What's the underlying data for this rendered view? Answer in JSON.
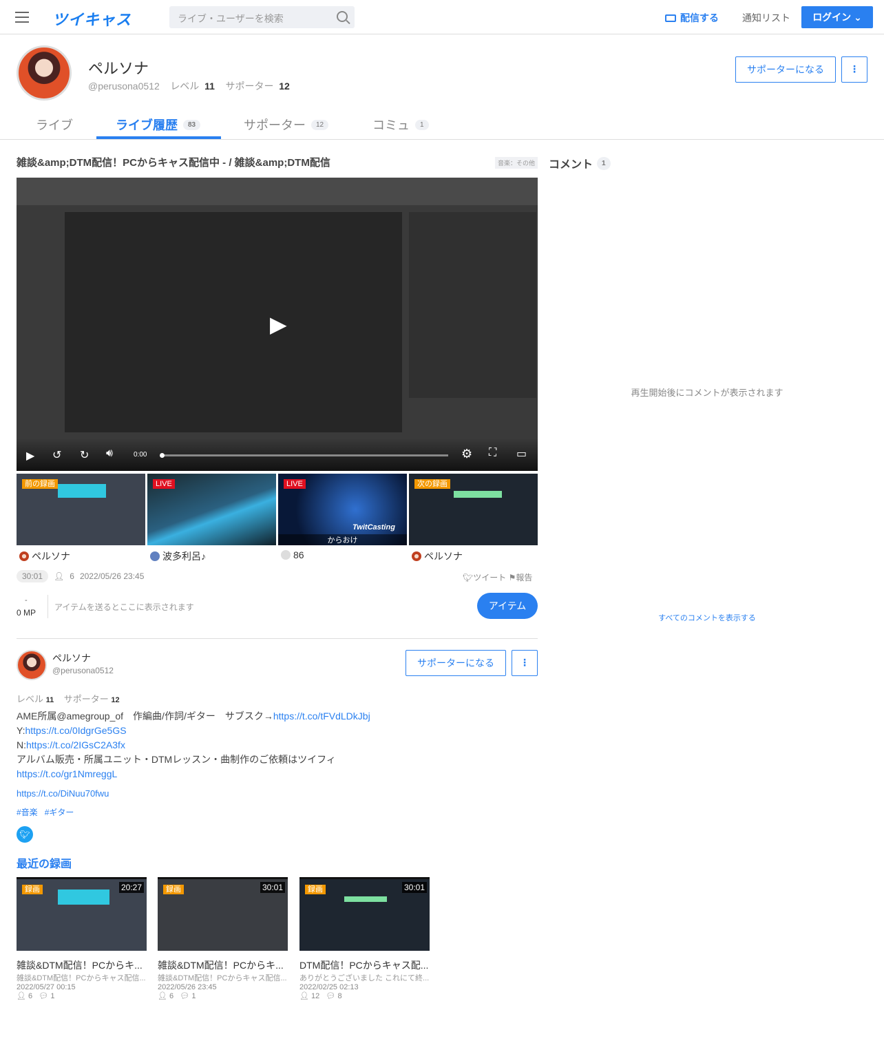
{
  "header": {
    "logo": "ツイキャス",
    "search_placeholder": "ライブ・ユーザーを検索",
    "broadcast": "配信する",
    "notify": "通知リスト",
    "login": "ログイン"
  },
  "profile": {
    "name": "ペルソナ",
    "handle": "@perusona0512",
    "level_label": "レベル",
    "level": "11",
    "supporter_label": "サポーター",
    "supporters": "12",
    "become_supporter": "サポーターになる"
  },
  "tabs": [
    {
      "label": "ライブ"
    },
    {
      "label": "ライブ履歴",
      "count": "83"
    },
    {
      "label": "サポーター",
      "count": "12"
    },
    {
      "label": "コミュ",
      "count": "1"
    }
  ],
  "movie": {
    "title": "雑談&amp;DTM配信！PCからキャス配信中 - / 雑談&amp;DTM配信",
    "category": "音楽：その他",
    "time": "0:00",
    "duration": "30:01",
    "viewers": "6",
    "date": "2022/05/26 23:45",
    "tweet": "ツイート",
    "report": "報告"
  },
  "related": [
    {
      "tag": "前の録画",
      "name": "ペルソナ"
    },
    {
      "tag": "LIVE",
      "name": "波多利呂♪"
    },
    {
      "tag": "LIVE",
      "name": "86",
      "caption": "からおけ",
      "brand": "TwitCasting"
    },
    {
      "tag": "次の録画",
      "name": "ペルソナ"
    }
  ],
  "items": {
    "dash": "-",
    "mp": "0 MP",
    "placeholder": "アイテムを送るとここに表示されます",
    "button": "アイテム"
  },
  "comments": {
    "title": "コメント",
    "count": "1",
    "empty": "再生開始後にコメントが表示されます",
    "show_all": "すべてのコメントを表示する"
  },
  "bio": {
    "line1": "AME所属@amegroup_of　作編曲/作詞/ギター　サブスク→",
    "link1": "https://t.co/tFVdLDkJbj",
    "y_label": "Y:",
    "link_y": "https://t.co/0IdgrGe5GS",
    "n_label": "N:",
    "link_n": "https://t.co/2IGsC2A3fx",
    "line4": "アルバム販売・所属ユニット・DTMレッスン・曲制作のご依頼はツイフィ",
    "link4": "https://t.co/gr1NmreggL",
    "link5": "https://t.co/DiNuu70fwu",
    "hashtags": [
      "#音楽",
      "#ギター"
    ]
  },
  "recent": {
    "title": "最近の録画",
    "items": [
      {
        "tag": "録画",
        "duration": "20:27",
        "title": "雑談&DTM配信！PCからキ...",
        "sub": "雑談&DTM配信！PCからキャス配信...",
        "date": "2022/05/27 00:15",
        "viewers": "6",
        "comments": "1"
      },
      {
        "tag": "録画",
        "duration": "30:01",
        "title": "雑談&DTM配信！PCからキ...",
        "sub": "雑談&DTM配信！PCからキャス配信...",
        "date": "2022/05/26 23:45",
        "viewers": "6",
        "comments": "1"
      },
      {
        "tag": "録画",
        "duration": "30:01",
        "title": "DTM配信！PCからキャス配...",
        "sub": "ありがとうございました これにて終...",
        "date": "2022/02/25 02:13",
        "viewers": "12",
        "comments": "8"
      }
    ]
  }
}
